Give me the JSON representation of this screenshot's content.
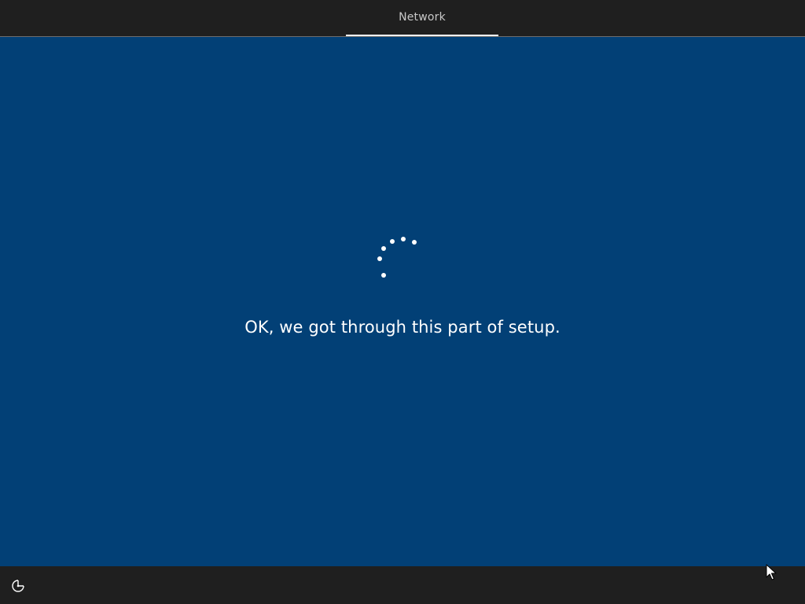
{
  "header": {
    "tabs": [
      {
        "label": "Network",
        "active": true
      }
    ]
  },
  "main": {
    "status_message": "OK, we got through this part of setup.",
    "spinner": {
      "icon": "loading-dots-spinner-icon"
    }
  },
  "footer": {
    "ease_of_access_icon": "ease-of-access-icon"
  },
  "colors": {
    "background": "#024076",
    "bars": "#1f1f1f",
    "text": "#ffffff",
    "tab_text": "#c8c8c8"
  }
}
